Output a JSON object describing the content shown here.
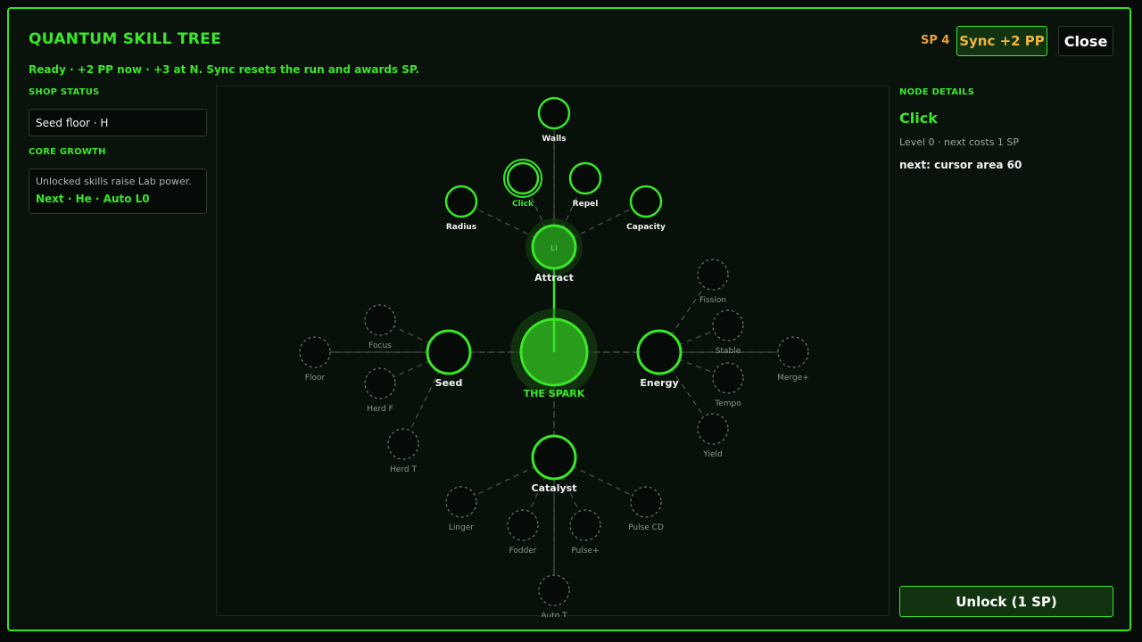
{
  "header": {
    "title": "QUANTUM SKILL TREE",
    "subtitle": "Ready · +2 PP now · +3 at N. Sync resets the run and awards SP.",
    "sp_label": "SP 4",
    "sync_label": "Sync +2 PP",
    "close_label": "Close"
  },
  "left": {
    "shop_status_label": "SHOP STATUS",
    "seed_floor": "Seed floor · H",
    "core_growth_label": "CORE GROWTH",
    "core_text": "Unlocked skills raise Lab power.",
    "core_next": "Next · He · Auto L0"
  },
  "details": {
    "label": "NODE DETAILS",
    "name": "Click",
    "level": "Level 0 · next costs 1 SP",
    "next": "next: cursor area 60",
    "unlock_label": "Unlock (1 SP)"
  },
  "colors": {
    "accent": "#3ae62a",
    "gold": "#e7a13a",
    "dim": "#707a70"
  },
  "tree": {
    "center_badge": "LI",
    "nodes": [
      {
        "id": "spark",
        "label": "THE SPARK",
        "state": "core"
      },
      {
        "id": "attract",
        "label": "Attract",
        "state": "major-unlocked"
      },
      {
        "id": "seed",
        "label": "Seed",
        "state": "major"
      },
      {
        "id": "energy",
        "label": "Energy",
        "state": "major"
      },
      {
        "id": "catalyst",
        "label": "Catalyst",
        "state": "major"
      },
      {
        "id": "walls",
        "label": "Walls",
        "state": "available"
      },
      {
        "id": "click",
        "label": "Click",
        "state": "selected"
      },
      {
        "id": "repel",
        "label": "Repel",
        "state": "available"
      },
      {
        "id": "radius",
        "label": "Radius",
        "state": "available"
      },
      {
        "id": "capacity",
        "label": "Capacity",
        "state": "available"
      },
      {
        "id": "focus",
        "label": "Focus",
        "state": "locked"
      },
      {
        "id": "floor",
        "label": "Floor",
        "state": "locked"
      },
      {
        "id": "herdf",
        "label": "Herd F",
        "state": "locked"
      },
      {
        "id": "herdt",
        "label": "Herd T",
        "state": "locked"
      },
      {
        "id": "fission",
        "label": "Fission",
        "state": "locked"
      },
      {
        "id": "stable",
        "label": "Stable",
        "state": "locked"
      },
      {
        "id": "merge",
        "label": "Merge+",
        "state": "locked"
      },
      {
        "id": "tempo",
        "label": "Tempo",
        "state": "locked"
      },
      {
        "id": "yield",
        "label": "Yield",
        "state": "locked"
      },
      {
        "id": "linger",
        "label": "Linger",
        "state": "locked"
      },
      {
        "id": "fodder",
        "label": "Fodder",
        "state": "locked"
      },
      {
        "id": "pulseplus",
        "label": "Pulse+",
        "state": "locked"
      },
      {
        "id": "pulsecd",
        "label": "Pulse CD",
        "state": "locked"
      },
      {
        "id": "autot",
        "label": "Auto T",
        "state": "locked"
      }
    ],
    "links": [
      [
        "spark",
        "attract",
        "active"
      ],
      [
        "spark",
        "seed",
        "dashed"
      ],
      [
        "spark",
        "energy",
        "dashed"
      ],
      [
        "spark",
        "catalyst",
        "dashed"
      ],
      [
        "attract",
        "walls",
        "dashed"
      ],
      [
        "attract",
        "click",
        "dashed"
      ],
      [
        "attract",
        "repel",
        "dashed"
      ],
      [
        "attract",
        "radius",
        "dashed"
      ],
      [
        "attract",
        "capacity",
        "dashed"
      ],
      [
        "seed",
        "focus",
        "dashed"
      ],
      [
        "seed",
        "floor",
        "dashed"
      ],
      [
        "seed",
        "herdf",
        "dashed"
      ],
      [
        "seed",
        "herdt",
        "dashed"
      ],
      [
        "energy",
        "fission",
        "dashed"
      ],
      [
        "energy",
        "stable",
        "dashed"
      ],
      [
        "energy",
        "merge",
        "dashed"
      ],
      [
        "energy",
        "tempo",
        "dashed"
      ],
      [
        "energy",
        "yield",
        "dashed"
      ],
      [
        "catalyst",
        "linger",
        "dashed"
      ],
      [
        "catalyst",
        "fodder",
        "dashed"
      ],
      [
        "catalyst",
        "pulseplus",
        "dashed"
      ],
      [
        "catalyst",
        "pulsecd",
        "dashed"
      ],
      [
        "catalyst",
        "autot",
        "dashed"
      ]
    ]
  }
}
